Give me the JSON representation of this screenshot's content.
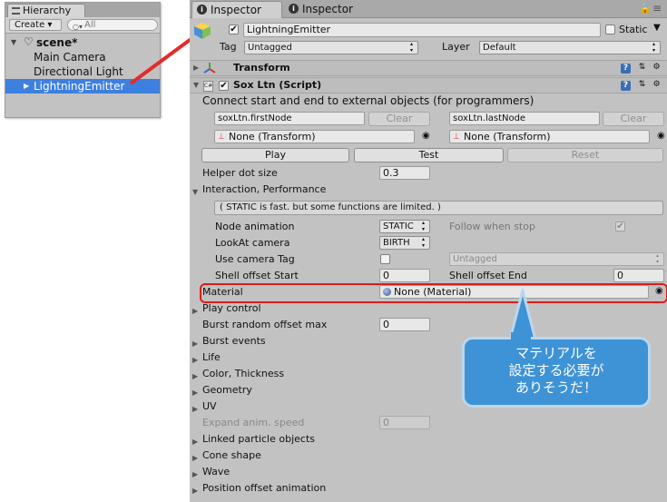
{
  "hierarchy": {
    "tab_label": "Hierarchy",
    "create_label": "Create ▾",
    "search_placeholder": "All",
    "scene_name": "scene*",
    "items": [
      "Main Camera",
      "Directional Light",
      "LightningEmitter"
    ],
    "selected": "LightningEmitter"
  },
  "inspector": {
    "tabs": [
      "Inspector",
      "Inspector"
    ],
    "object_name": "LightningEmitter",
    "static_label": "Static",
    "tag_label": "Tag",
    "tag_value": "Untagged",
    "layer_label": "Layer",
    "layer_value": "Default",
    "transform_title": "Transform",
    "script_title": "Sox Ltn (Script)",
    "connect_hint": "Connect start and end to external objects (for programmers)",
    "first_node": "soxLtn.firstNode",
    "last_node": "soxLtn.lastNode",
    "clear_label": "Clear",
    "none_transform": "None (Transform)",
    "play_label": "Play",
    "test_label": "Test",
    "reset_label": "Reset",
    "helper_dot_label": "Helper dot size",
    "helper_dot_value": "0.3",
    "interaction_title": "Interaction, Performance",
    "static_hint": "( STATIC is fast. but some functions are limited. )",
    "node_animation_label": "Node animation",
    "node_animation_value": "STATIC",
    "follow_when_stop_label": "Follow when stop",
    "lookat_label": "LookAt camera",
    "lookat_value": "BIRTH",
    "use_camera_tag_label": "Use camera Tag",
    "camera_tag_value": "Untagged",
    "shell_start_label": "Shell offset Start",
    "shell_start_value": "0",
    "shell_end_label": "Shell offset End",
    "shell_end_value": "0",
    "material_label": "Material",
    "material_value": "None (Material)",
    "play_control": "Play control",
    "burst_random_label": "Burst random offset max",
    "burst_random_value": "0",
    "sections_a": [
      "Burst events",
      "Life",
      "Color, Thickness",
      "Geometry",
      "UV"
    ],
    "expand_anim_label": "Expand anim. speed",
    "expand_anim_value": "0",
    "sections_b": [
      "Linked particle objects",
      "Cone shape",
      "Wave",
      "Position offset animation"
    ]
  },
  "annotation": {
    "callout_lines": [
      "マテリアルを",
      "設定する必要が",
      "ありそうだ！"
    ],
    "highlight_color": "#e01b1b",
    "callout_color": "#3e92d6"
  }
}
